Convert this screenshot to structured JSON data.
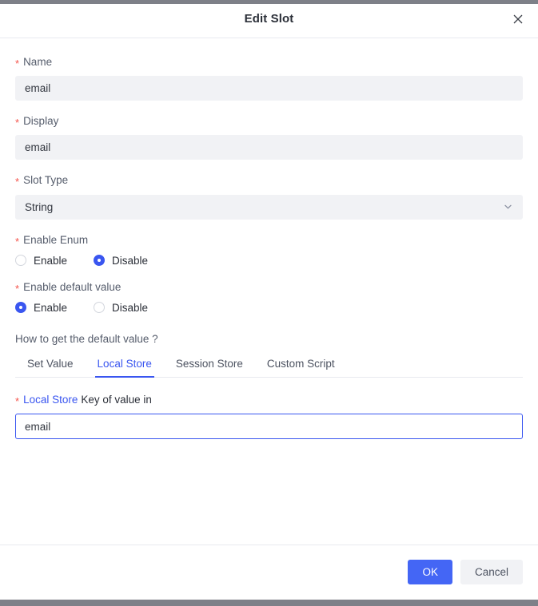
{
  "dialog": {
    "title": "Edit Slot",
    "close_icon": "close-icon"
  },
  "fields": {
    "name": {
      "label": "Name",
      "required_marker": "*",
      "value": "email"
    },
    "display": {
      "label": "Display",
      "required_marker": "*",
      "value": "email"
    },
    "slot_type": {
      "label": "Slot Type",
      "required_marker": "*",
      "value": "String",
      "chevron_icon": "chevron-down-icon",
      "options": [
        "String"
      ]
    },
    "enable_enum": {
      "label": "Enable Enum",
      "required_marker": "*",
      "options": [
        {
          "label": "Enable",
          "selected": false
        },
        {
          "label": "Disable",
          "selected": true
        }
      ]
    },
    "enable_default_value": {
      "label": "Enable default value",
      "required_marker": "*",
      "options": [
        {
          "label": "Enable",
          "selected": true
        },
        {
          "label": "Disable",
          "selected": false
        }
      ]
    }
  },
  "default_value_section": {
    "question": "How to get the default value ?",
    "tabs": [
      {
        "label": "Set Value",
        "active": false
      },
      {
        "label": "Local Store",
        "active": true
      },
      {
        "label": "Session Store",
        "active": false
      },
      {
        "label": "Custom Script",
        "active": false
      }
    ],
    "key_field": {
      "required_marker": "*",
      "label_highlight": "Local Store",
      "label_rest": "Key of value in",
      "value": "email"
    }
  },
  "footer": {
    "ok_label": "OK",
    "cancel_label": "Cancel"
  },
  "colors": {
    "accent": "#3a56f0",
    "primary_button": "#4466f5",
    "required": "#f5544c",
    "field_bg": "#f1f2f5",
    "label": "#565d6c",
    "scrollbar": "#7e8088"
  }
}
